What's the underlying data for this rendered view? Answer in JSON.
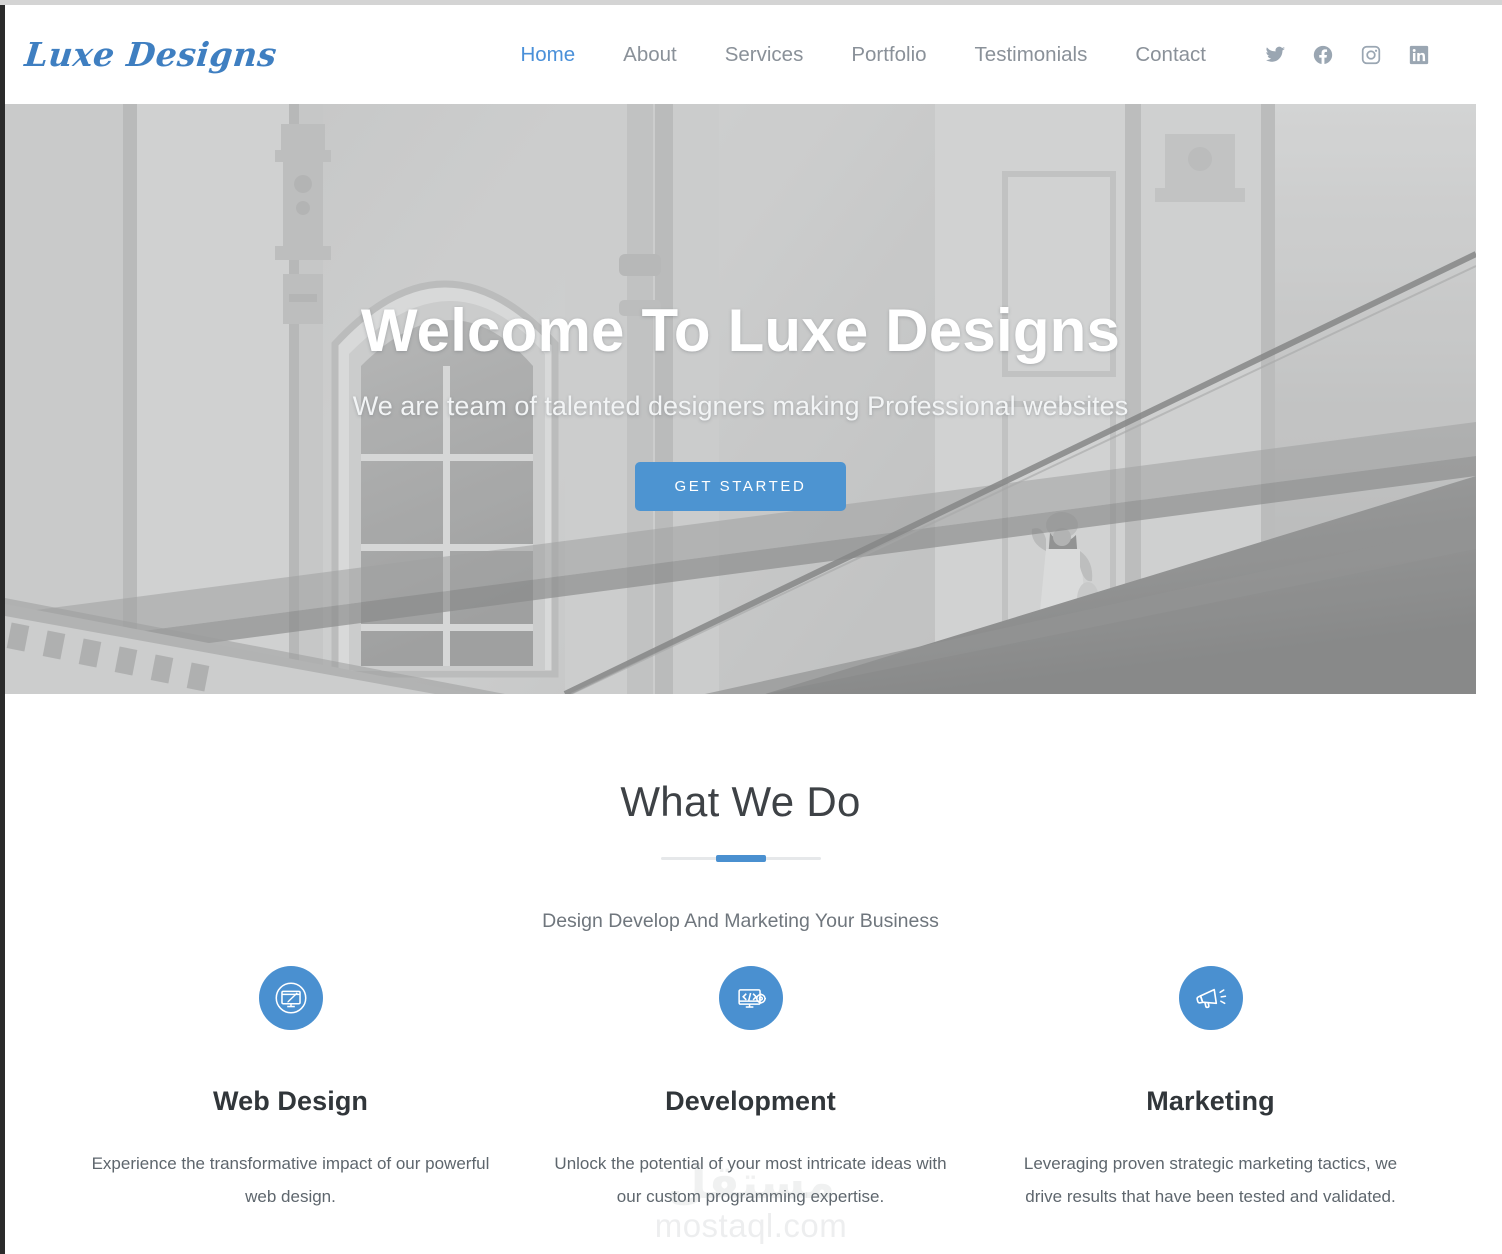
{
  "brand": {
    "name": "Luxe Designs"
  },
  "nav": {
    "items": [
      {
        "label": "Home",
        "active": true
      },
      {
        "label": "About",
        "active": false
      },
      {
        "label": "Services",
        "active": false
      },
      {
        "label": "Portfolio",
        "active": false
      },
      {
        "label": "Testimonials",
        "active": false
      },
      {
        "label": "Contact",
        "active": false
      }
    ],
    "socials": [
      {
        "name": "twitter-icon"
      },
      {
        "name": "facebook-icon"
      },
      {
        "name": "instagram-icon"
      },
      {
        "name": "linkedin-icon"
      }
    ]
  },
  "hero": {
    "title": "Welcome To Luxe Designs",
    "subtitle": "We are team of talented designers making Professional websites",
    "cta_label": "GET STARTED",
    "image_alt": "classical-building-facade-photo"
  },
  "services": {
    "title": "What We Do",
    "subtitle": "Design Develop And Marketing Your Business",
    "cards": [
      {
        "icon": "monitor-pen-icon",
        "title": "Web Design",
        "text": "Experience the transformative impact of our powerful web design."
      },
      {
        "icon": "code-gear-icon",
        "title": "Development",
        "text": "Unlock the potential of your most intricate ideas with our custom programming expertise."
      },
      {
        "icon": "megaphone-icon",
        "title": "Marketing",
        "text": "Leveraging proven strategic marketing tactics, we drive results that have been tested and validated."
      }
    ]
  },
  "watermark": {
    "arabic": "مستقل",
    "latin": "mostaql.com"
  },
  "colors": {
    "accent": "#4a90d0",
    "accent_button": "#4d94d1",
    "nav_active": "#4a90d9",
    "nav_inactive": "#8a9199",
    "brand": "#3f7fc1",
    "heading": "#3e4246",
    "body_text": "#5e666d"
  }
}
